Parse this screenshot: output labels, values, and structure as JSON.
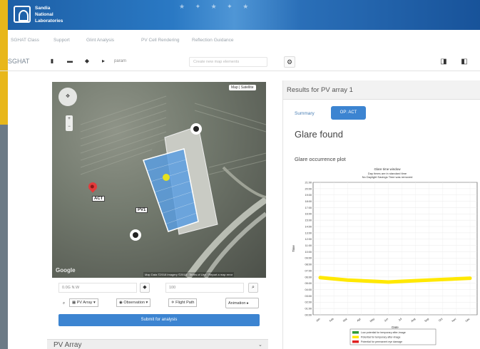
{
  "header": {
    "org_lines": [
      "Sandia",
      "National",
      "Laboratories"
    ],
    "stars": "★ ✦ ★ ✦ ★"
  },
  "nav": {
    "items": [
      "SGHAT Class",
      "Support",
      "Glint Analysis",
      "PV Cell Rendering",
      "Reflection Guidance"
    ]
  },
  "toolbar": {
    "title": "SGHAT",
    "project_label": "param",
    "search_placeholder": "Create new map elements"
  },
  "map": {
    "map_type": "Map | Satellite",
    "pan_label": "✥",
    "zoom_plus": "+",
    "zoom_minus": "−",
    "google": "Google",
    "credits": "Map Data ©2018 Imagery ©2018 · Terms of Use · Report a map error",
    "observation_point_label": "ACT",
    "pv_array_label": "PV1"
  },
  "controls": {
    "coord_value": "0.0G N.W",
    "height_value": "100",
    "search_icon": "⌕",
    "pv_array_btn": "PV Array",
    "observation_btn": "Observation",
    "flight_path_btn": "Flight Path",
    "animation_btn": "Animation",
    "submit_label": "Submit for analysis",
    "pv_array_section": "PV Array",
    "chevron": "⌄"
  },
  "results": {
    "title": "Results for PV array 1",
    "tab_summary": "Summary",
    "tab_active": "OP: ACT",
    "status": "Glare found",
    "plot_heading": "Glare occurrence plot"
  },
  "colors": {
    "header_blue": "#1d5fa6",
    "primary_button": "#3c84d1",
    "gold_strip": "#e8b71a",
    "slate_strip": "#6c7a86",
    "glare_yellow": "#ffe800",
    "legend_green": "#2e9a38",
    "legend_yellow": "#ffe800",
    "legend_red": "#e02020"
  },
  "chart_data": {
    "type": "line",
    "title": "Glare time window",
    "subtitle_lines": [
      "Day times are in standard time",
      "No Daylight Savings Time was removed"
    ],
    "xlabel": "Date",
    "ylabel": "Time",
    "x": [
      "Jan",
      "Feb",
      "Mar",
      "Apr",
      "May",
      "Jun",
      "Jul",
      "Aug",
      "Sep",
      "Oct",
      "Nov",
      "Dec"
    ],
    "y_ticks": [
      "21:00",
      "20:00",
      "19:00",
      "18:00",
      "17:00",
      "16:00",
      "15:00",
      "14:00",
      "13:00",
      "12:00",
      "11:00",
      "10:00",
      "09:00",
      "08:00",
      "07:00",
      "06:00",
      "05:00",
      "04:00",
      "03:00",
      "02:00",
      "01:00",
      "00:00"
    ],
    "ylim": [
      0,
      21
    ],
    "series": [
      {
        "name": "",
        "color": "#ffe800",
        "values": [
          5.9,
          5.7,
          5.5,
          5.4,
          5.3,
          5.2,
          5.3,
          5.4,
          5.5,
          5.6,
          5.7,
          5.8
        ]
      }
    ],
    "legend": [
      {
        "label": "Low potential for temporary after-image",
        "color": "#2e9a38"
      },
      {
        "label": "Potential for temporary after-image",
        "color": "#ffe800"
      },
      {
        "label": "Potential for permanent eye damage",
        "color": "#e02020"
      }
    ],
    "legend_position": "bottom-right"
  }
}
